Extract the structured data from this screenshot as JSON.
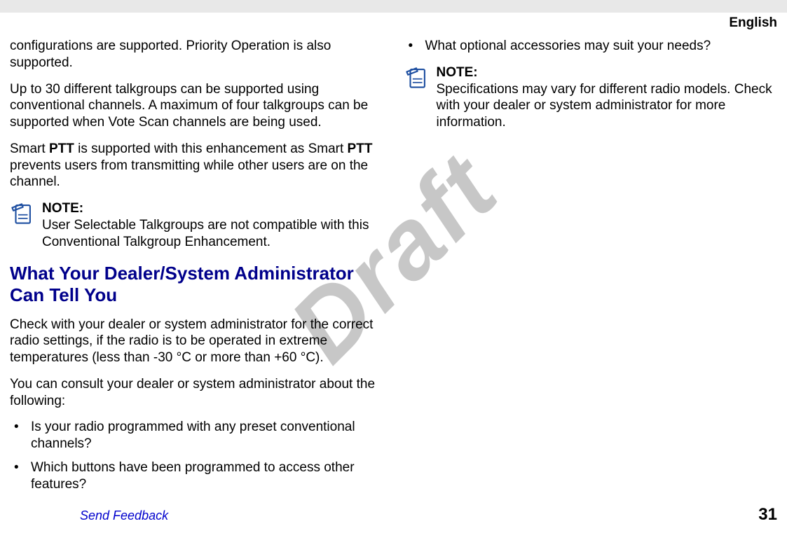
{
  "language": "English",
  "watermark": "Draft",
  "left": {
    "p1": "configurations are supported. Priority Operation is also supported.",
    "p2": "Up to 30 different talkgroups can be supported using conventional channels. A maximum of four talkgroups can be supported when Vote Scan channels are being used.",
    "p3a": "Smart ",
    "p3b": "PTT",
    "p3c": " is supported with this enhancement as Smart ",
    "p3d": "PTT",
    "p3e": " prevents users from transmitting while other users are on the channel.",
    "note1_label": "NOTE:",
    "note1_body": "User Selectable Talkgroups are not compatible with this Conventional Talkgroup Enhancement.",
    "heading": "What Your Dealer/System Administrator Can Tell You",
    "p4": "Check with your dealer or system administrator for the correct radio settings, if the radio is to be operated in extreme temperatures (less than -30 °C or more than +60 °C).",
    "p5": "You can consult your dealer or system administrator about the following:",
    "b1": "Is your radio programmed with any preset conventional channels?"
  },
  "right": {
    "b2": "Which buttons have been programmed to access other features?",
    "b3": "What optional accessories may suit your needs?",
    "note2_label": "NOTE:",
    "note2_body": "Specifications may vary for different radio models. Check with your dealer or system administrator for more information."
  },
  "footer": {
    "feedback": "Send Feedback",
    "page": "31"
  }
}
